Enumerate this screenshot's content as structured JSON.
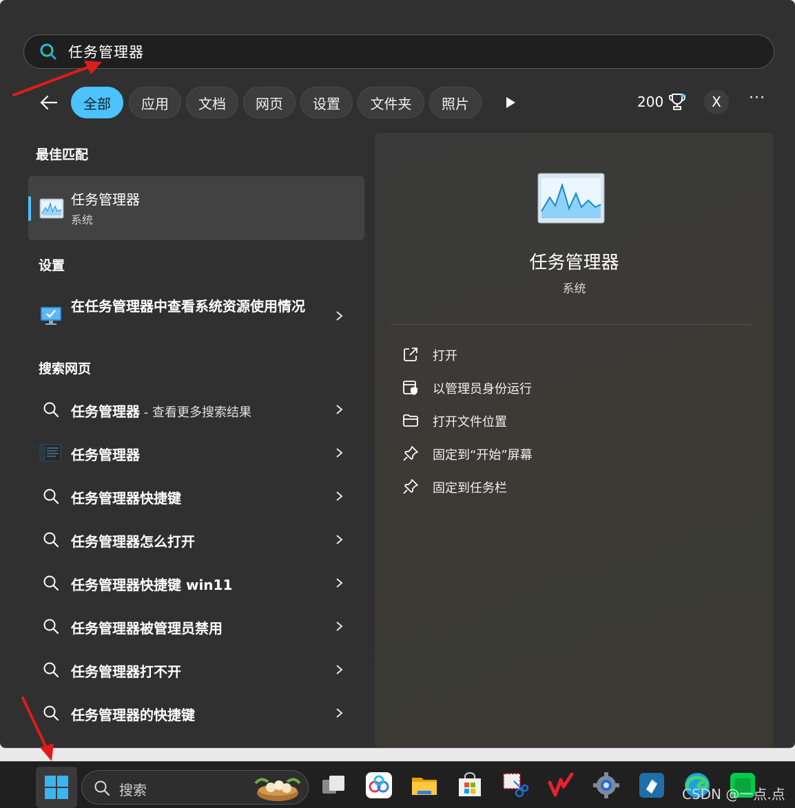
{
  "search": {
    "query": "任务管理器"
  },
  "filters": {
    "tabs": [
      {
        "label": "全部",
        "active": true
      },
      {
        "label": "应用",
        "active": false
      },
      {
        "label": "文档",
        "active": false
      },
      {
        "label": "网页",
        "active": false
      },
      {
        "label": "设置",
        "active": false
      },
      {
        "label": "文件夹",
        "active": false
      },
      {
        "label": "照片",
        "active": false
      }
    ],
    "points": "200",
    "avatar_initial": "X",
    "more_label": "···"
  },
  "best_match": {
    "section_title": "最佳匹配",
    "name": "任务管理器",
    "subtitle": "系统"
  },
  "settings": {
    "section_title": "设置",
    "item_label": "在任务管理器中查看系统资源使用情况"
  },
  "web": {
    "section_title": "搜索网页",
    "first_query": "任务管理器",
    "first_suffix": " - 查看更多搜索结果",
    "items": [
      {
        "label": "任务管理器",
        "icon": "task-manager-app-icon"
      },
      {
        "label": "任务管理器快捷键",
        "icon": "search-icon"
      },
      {
        "label": "任务管理器怎么打开",
        "icon": "search-icon"
      },
      {
        "label": "任务管理器快捷键 win11",
        "icon": "search-icon"
      },
      {
        "label": "任务管理器被管理员禁用",
        "icon": "search-icon"
      },
      {
        "label": "任务管理器打不开",
        "icon": "search-icon"
      },
      {
        "label": "任务管理器的快捷键",
        "icon": "search-icon"
      }
    ]
  },
  "detail": {
    "name": "任务管理器",
    "subtitle": "系统",
    "actions": [
      {
        "label": "打开",
        "icon": "open-external-icon"
      },
      {
        "label": "以管理员身份运行",
        "icon": "run-as-admin-icon"
      },
      {
        "label": "打开文件位置",
        "icon": "folder-icon"
      },
      {
        "label": "固定到“开始”屏幕",
        "icon": "pin-icon"
      },
      {
        "label": "固定到任务栏",
        "icon": "pin-icon"
      }
    ]
  },
  "taskbar": {
    "search_label": "搜索",
    "apps": [
      "task-view-icon",
      "baidu-netdisk-icon",
      "file-explorer-icon",
      "microsoft-store-icon",
      "snipping-tool-icon",
      "wps-icon",
      "settings-gear-icon",
      "app-icon",
      "edge-icon",
      "iqiyi-icon"
    ]
  },
  "watermark": "CSDN @一点.点",
  "colors": {
    "accent": "#4cc2ff",
    "panel": "#303030",
    "annotation": "#e01b1b"
  }
}
